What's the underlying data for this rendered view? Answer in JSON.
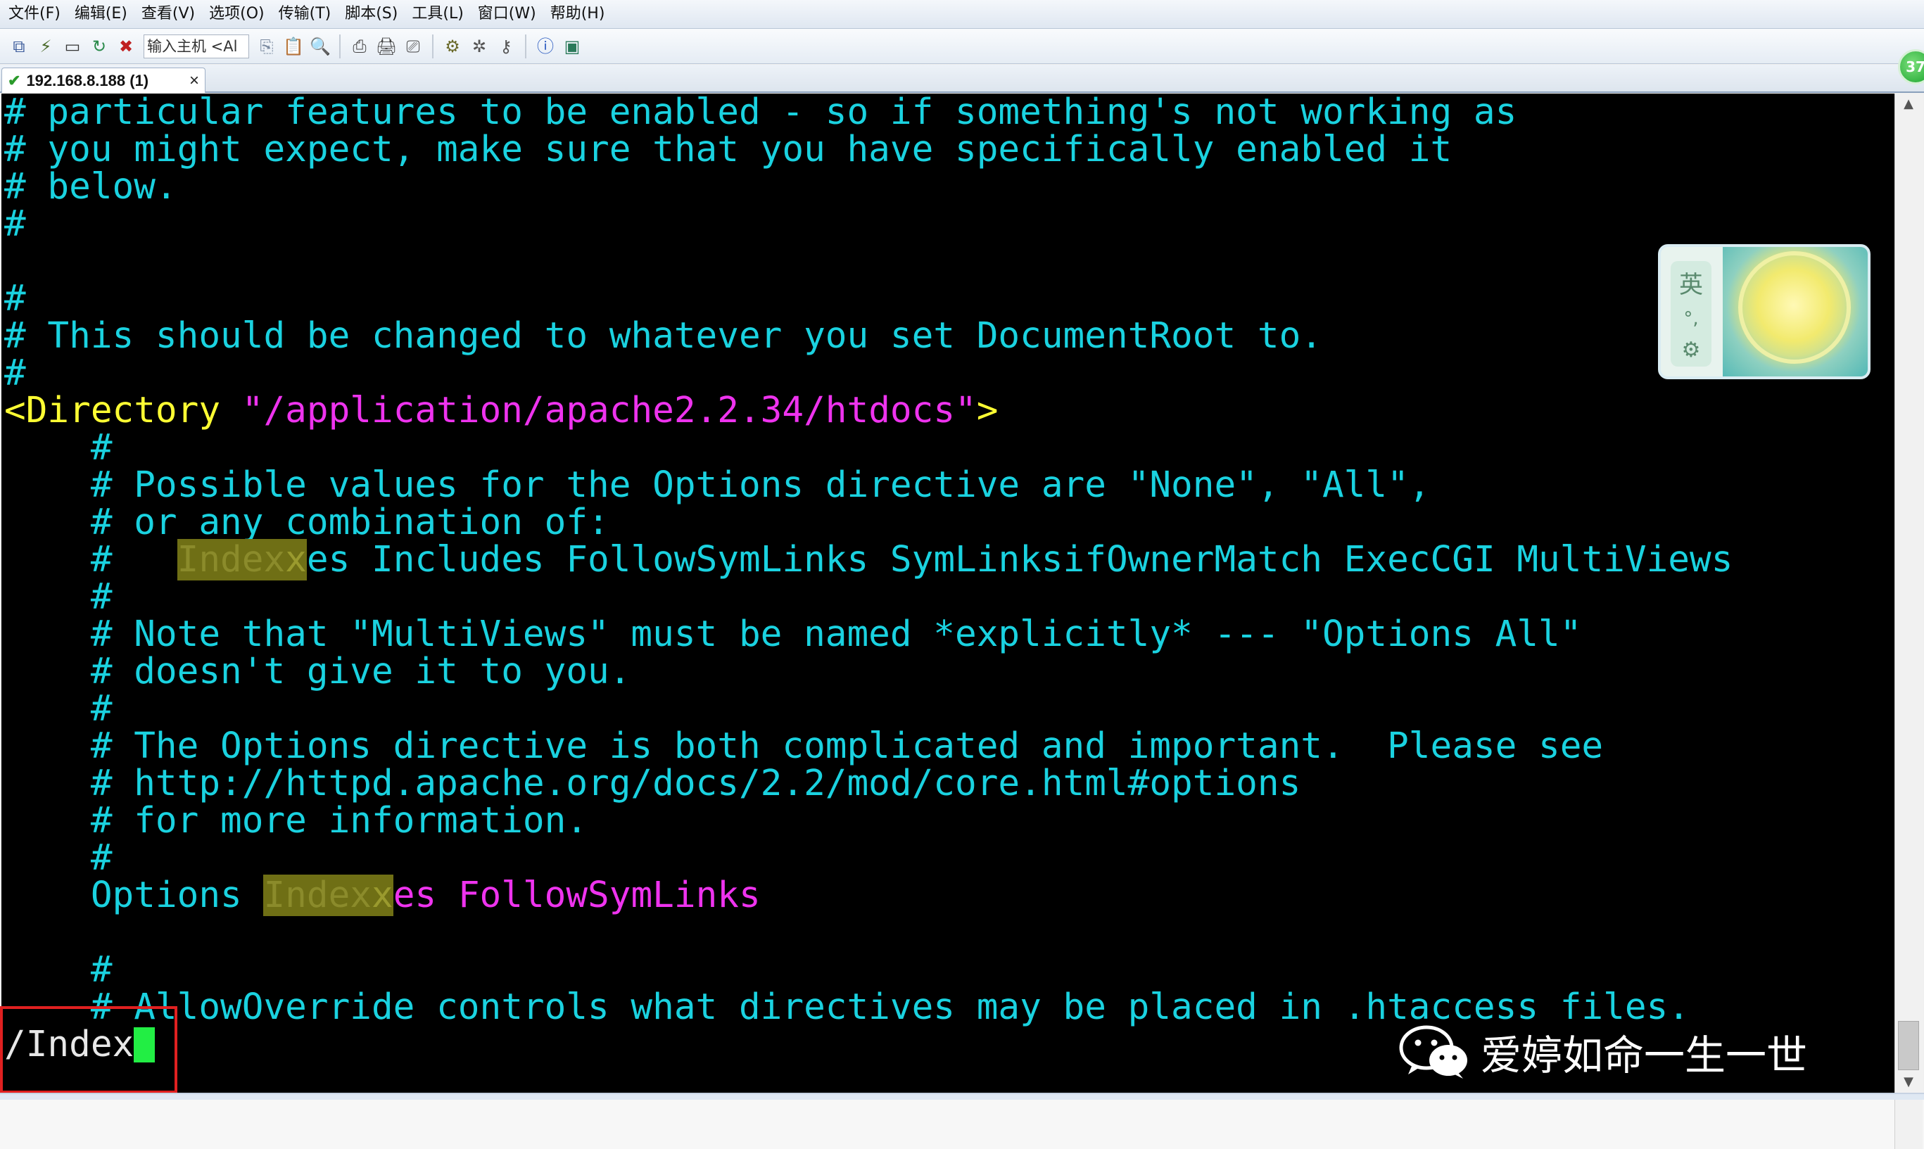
{
  "menu": [
    "文件(F)",
    "编辑(E)",
    "查看(V)",
    "选项(O)",
    "传输(T)",
    "脚本(S)",
    "工具(L)",
    "窗口(W)",
    "帮助(H)"
  ],
  "toolbar": {
    "host_input_value": "输入主机 <Al",
    "icons": [
      "connect-icon",
      "quick-connect-icon",
      "session-manager-icon",
      "reconnect-icon",
      "disconnect-icon",
      "copy-icon",
      "paste-icon",
      "find-icon",
      "print-setup-icon",
      "print-icon",
      "print-screen-icon",
      "session-options-icon",
      "global-options-icon",
      "keymap-icon",
      "help-icon",
      "sftp-icon"
    ]
  },
  "tab": {
    "title": "192.168.8.188 (1)",
    "close": "×",
    "status": "✔"
  },
  "badge": {
    "value": "37"
  },
  "terminal": {
    "lines": [
      "# particular features to be enabled - so if something's not working as",
      "# you might expect, make sure that you have specifically enabled it",
      "# below.",
      "#",
      "",
      "#",
      "# This should be changed to whatever you set DocumentRoot to.",
      "#",
      {
        "dir_open": "<Directory ",
        "dir_path": "\"/application/apache2.2.34/htdocs\"",
        "dir_close": ">"
      },
      "    #",
      "    # Possible values for the Options directive are \"None\", \"All\",",
      "    # or any combination of:",
      {
        "pre": "    #   ",
        "match": "Index",
        "match_tail": "x",
        "post": "es Includes FollowSymLinks SymLinksifOwnerMatch ExecCGI MultiViews"
      },
      "    #",
      "    # Note that \"MultiViews\" must be named *explicitly* --- \"Options All\"",
      "    # doesn't give it to you.",
      "    #",
      "    # The Options directive is both complicated and important.  Please see",
      "    # http://httpd.apache.org/docs/2.2/mod/core.html#options",
      "    # for more information.",
      "    #",
      {
        "keyword": "    Options ",
        "match": "Index",
        "match_tail": "x",
        "post": "es FollowSymLinks"
      },
      "",
      "    #",
      "    # AllowOverride controls what directives may be placed in .htaccess files."
    ],
    "search_prompt": "/Index"
  },
  "ime": {
    "lang": "英",
    "punct": "°,",
    "settings": "⚙"
  },
  "watermark": {
    "text": "爱婷如命一生一世"
  },
  "colors": {
    "comment": "#1ad2e0",
    "tag": "#ffff33",
    "string": "#ee33ee",
    "search_highlight": "#6f6f15",
    "cursor": "#22ee44",
    "annotation_box": "#e02020"
  }
}
